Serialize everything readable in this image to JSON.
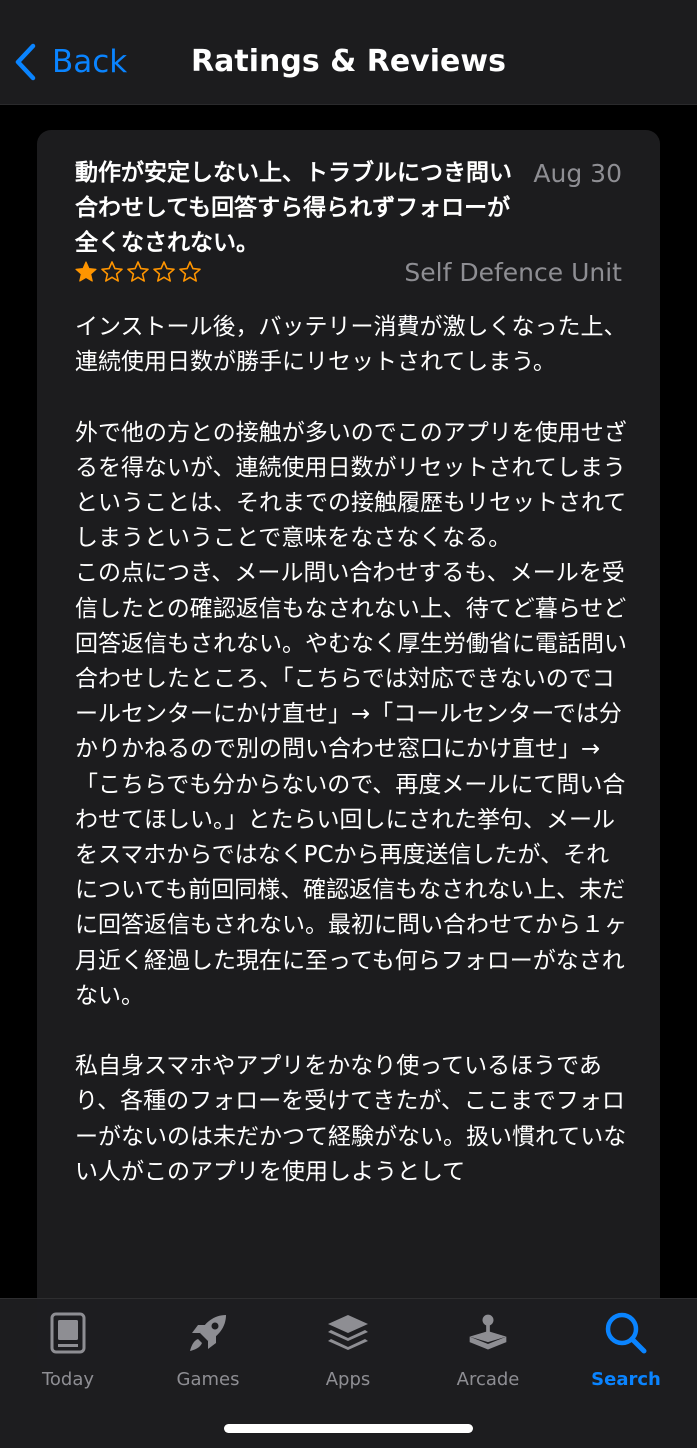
{
  "nav": {
    "back_label": "Back",
    "title": "Ratings & Reviews"
  },
  "review": {
    "title": "動作が安定しない上、トラブルにつき問い合わせしても回答すら得られずフォローが全くなされない。",
    "date": "Aug 30",
    "rating": 1,
    "rating_max": 5,
    "author": "Self Defence Unit",
    "body": "インストール後，バッテリー消費が激しくなった上、連続使用日数が勝手にリセットされてしまう。\n\n外で他の方との接触が多いのでこのアプリを使用せざるを得ないが、連続使用日数がリセットされてしまうということは、それまでの接触履歴もリセットされてしまうということで意味をなさなくなる。\nこの点につき、メール問い合わせするも、メールを受信したとの確認返信もなされない上、待てど暮らせど回答返信もされない。やむなく厚生労働省に電話問い合わせしたところ、「こちらでは対応できないのでコールセンターにかけ直せ」→「コールセンターでは分かりかねるので別の問い合わせ窓口にかけ直せ」→「こちらでも分からないので、再度メールにて問い合わせてほしい。」とたらい回しにされた挙句、メールをスマホからではなくPCから再度送信したが、それについても前回同様、確認返信もなされない上、未だに回答返信もされない。最初に問い合わせてから１ヶ月近く経過した現在に至っても何らフォローがなされない。\n\n私自身スマホやアプリをかなり使っているほうであり、各種のフォローを受けてきたが、ここまでフォローがないのは未だかつて経験がない。扱い慣れていない人がこのアプリを使用しようとして"
  },
  "colors": {
    "accent": "#0a84ff",
    "star": "#ff9500",
    "secondary_text": "#8e8e93"
  },
  "tabs": [
    {
      "label": "Today",
      "icon": "today-icon",
      "active": false
    },
    {
      "label": "Games",
      "icon": "rocket-icon",
      "active": false
    },
    {
      "label": "Apps",
      "icon": "apps-stack-icon",
      "active": false
    },
    {
      "label": "Arcade",
      "icon": "joystick-icon",
      "active": false
    },
    {
      "label": "Search",
      "icon": "search-icon",
      "active": true
    }
  ]
}
